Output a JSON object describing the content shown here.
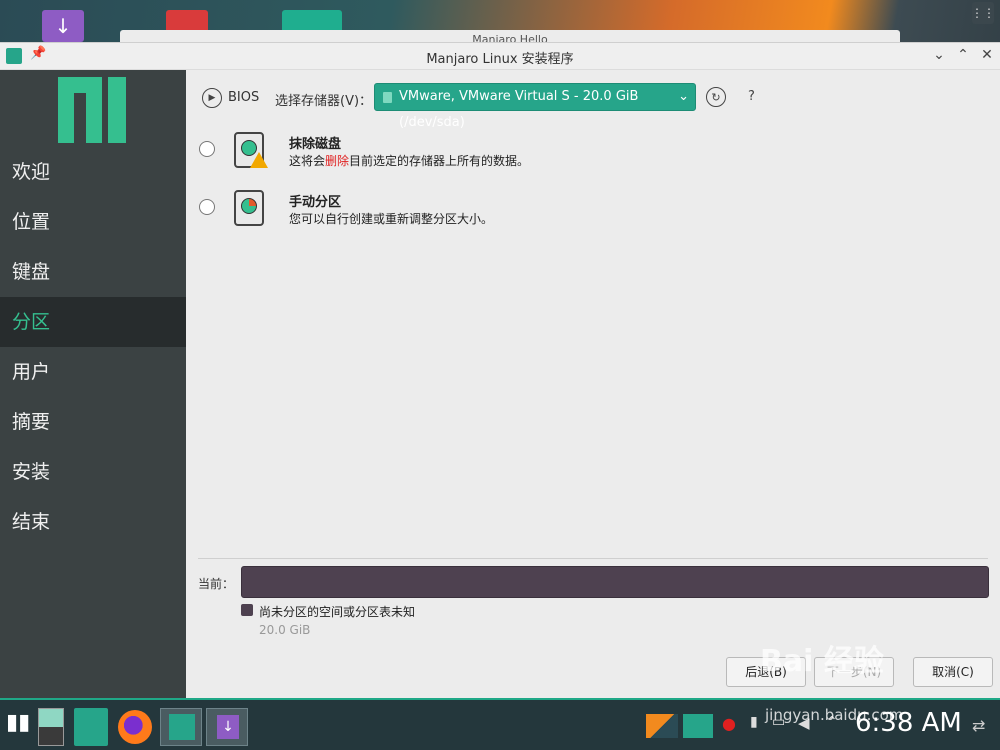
{
  "window": {
    "title": "Manjaro Linux 安装程序",
    "behind_title": "Manjaro Hello"
  },
  "sidebar": {
    "items": [
      {
        "label": "欢迎"
      },
      {
        "label": "位置"
      },
      {
        "label": "键盘"
      },
      {
        "label": "分区",
        "active": true
      },
      {
        "label": "用户"
      },
      {
        "label": "摘要"
      },
      {
        "label": "安装"
      },
      {
        "label": "结束"
      }
    ]
  },
  "toolbar": {
    "bios_label": "BIOS",
    "storage_label": "选择存储器(V)：",
    "storage_value": "VMware, VMware Virtual S - 20.0 GiB (/dev/sda)",
    "help_label": "?"
  },
  "options": [
    {
      "title": "抹除磁盘",
      "desc_before": "这将会",
      "desc_highlight": "删除",
      "desc_after": "目前选定的存储器上所有的数据。"
    },
    {
      "title": "手动分区",
      "desc": "您可以自行创建或重新调整分区大小。"
    }
  ],
  "current": {
    "label": "当前：",
    "legend_label": "尚未分区的空间或分区表未知",
    "legend_size": "20.0 GiB"
  },
  "buttons": {
    "back": "后退(B)",
    "next": "下一步(N)",
    "cancel": "取消(C)"
  },
  "taskbar": {
    "clock": "6:38 AM"
  },
  "watermark": {
    "text": "Bai 经验",
    "sub": "jingyan.baidu.com"
  },
  "colors": {
    "accent": "#26a58a",
    "sidebar_bg": "#3b4243",
    "sidebar_active_text": "#35bf8f",
    "partition_bar": "#4e4150"
  }
}
